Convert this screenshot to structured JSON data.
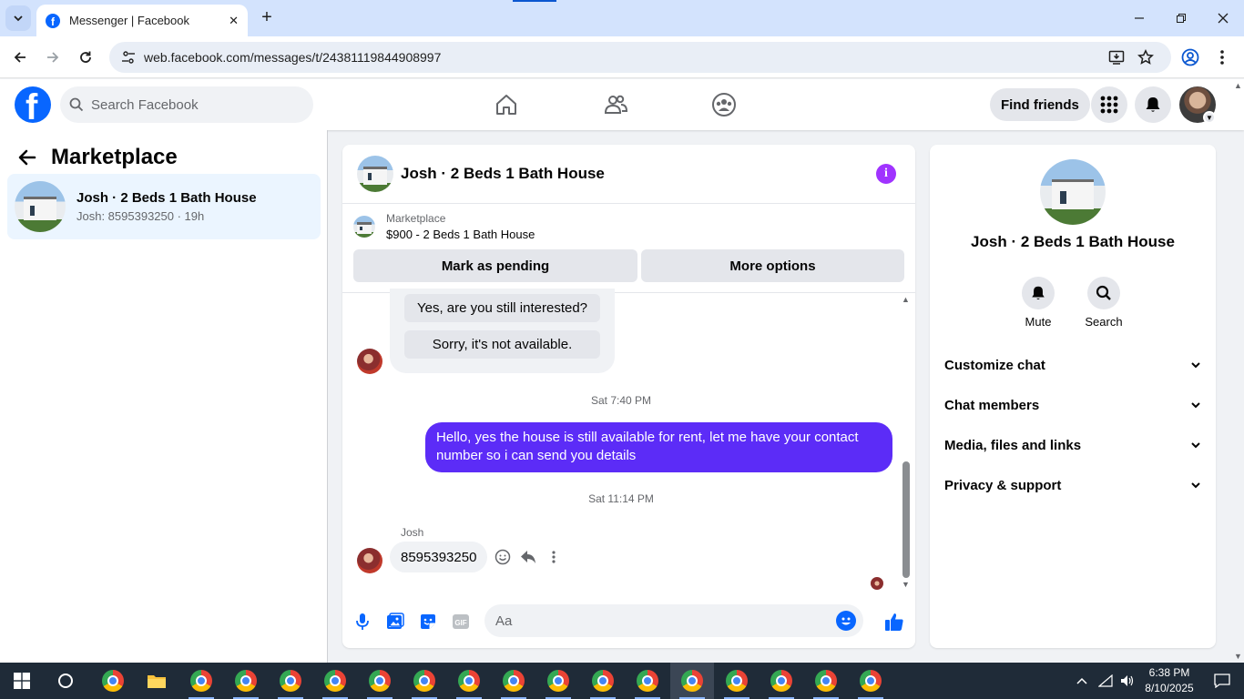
{
  "browser": {
    "tab_title": "Messenger | Facebook",
    "url": "web.facebook.com/messages/t/24381119844908997"
  },
  "fb_header": {
    "logo": "f",
    "search_placeholder": "Search Facebook",
    "find_friends": "Find friends"
  },
  "left_panel": {
    "title": "Marketplace",
    "conversation": {
      "name": "Josh · 2 Beds 1 Bath House",
      "preview": "Josh: 8595393250 · 19h"
    }
  },
  "chat": {
    "title": "Josh · 2 Beds 1 Bath House",
    "info_glyph": "i",
    "marketplace_label": "Marketplace",
    "listing": "$900 - 2 Beds 1 Bath House",
    "mark_pending": "Mark as pending",
    "more_options": "More options",
    "quick_replies": [
      "Yes, are you still interested?",
      "Sorry, it's not available."
    ],
    "messages": [
      {
        "time": "Sat 7:40 PM",
        "from": "me",
        "text": "Hello, yes the house is still available for rent, let me have your contact number so i can send you  details"
      },
      {
        "time": "Sat 11:14 PM",
        "from": "Josh",
        "text": "8595393250"
      }
    ],
    "composer_placeholder": "Aa"
  },
  "right_panel": {
    "name": "Josh · 2 Beds 1 Bath House",
    "actions": [
      "Mute",
      "Search"
    ],
    "sections": [
      "Customize chat",
      "Chat members",
      "Media, files and links",
      "Privacy & support"
    ]
  },
  "taskbar": {
    "time": "6:38 PM",
    "date": "8/10/2025"
  },
  "colors": {
    "fb_blue": "#0866ff",
    "outgoing_bubble": "#5c2cf7",
    "info_purple": "#a033ff",
    "taskbar": "#1f2b38"
  }
}
